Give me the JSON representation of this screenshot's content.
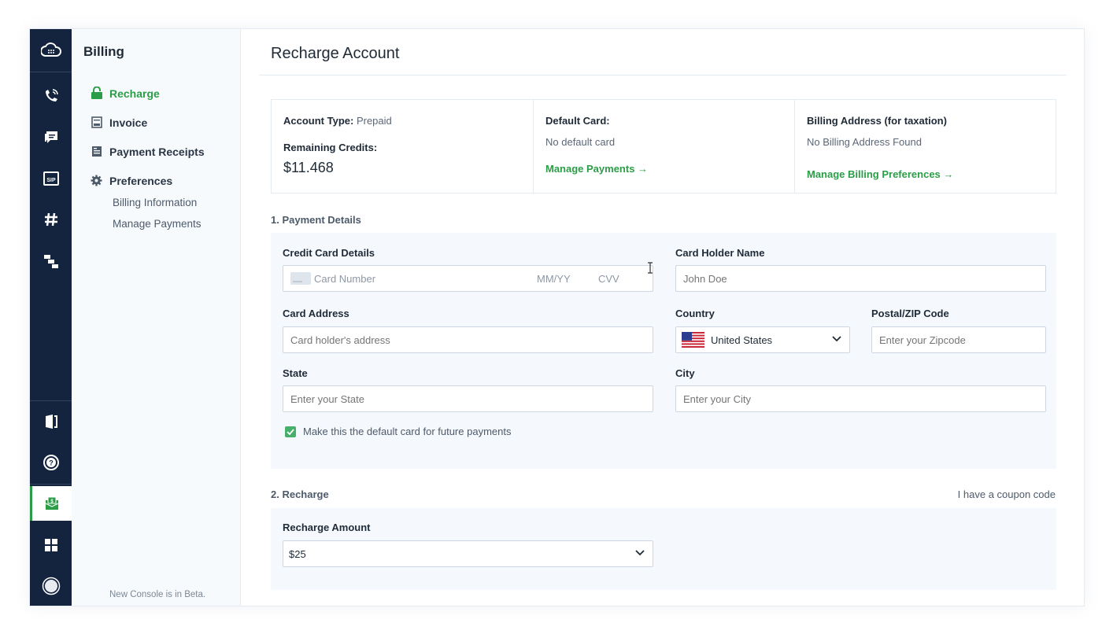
{
  "rail": {
    "icons": [
      "cloud-logo-icon",
      "phone-icon",
      "message-icon",
      "sip-icon",
      "hash-icon",
      "flow-icon",
      "docs-icon",
      "help-icon",
      "billing-icon",
      "apps-icon",
      "profile-icon"
    ],
    "sip_text": "SIP",
    "active": "billing-icon"
  },
  "sidebar": {
    "title": "Billing",
    "items": [
      {
        "label": "Recharge",
        "icon": "lock-icon",
        "active": true
      },
      {
        "label": "Invoice",
        "icon": "invoice-icon",
        "active": false
      },
      {
        "label": "Payment Receipts",
        "icon": "receipt-icon",
        "active": false
      },
      {
        "label": "Preferences",
        "icon": "gear-icon",
        "active": false
      }
    ],
    "sub_items": [
      "Billing Information",
      "Manage Payments"
    ],
    "footer": "New Console is in Beta."
  },
  "page": {
    "title": "Recharge Account"
  },
  "summary": {
    "account_type_label": "Account Type:",
    "account_type_value": "Prepaid",
    "remaining_label": "Remaining Credits:",
    "remaining_value": "$11.468",
    "default_card_label": "Default Card:",
    "default_card_value": "No default card",
    "manage_payments": "Manage Payments →",
    "billing_address_label": "Billing Address (for taxation)",
    "billing_address_value": "No Billing Address Found",
    "manage_billing": "Manage Billing Preferences →"
  },
  "payment": {
    "section_title": "1. Payment Details",
    "credit_card_label": "Credit Card Details",
    "card_number_placeholder": "Card Number",
    "expiry_placeholder": "MM/YY",
    "cvv_placeholder": "CVV",
    "holder_label": "Card Holder Name",
    "holder_placeholder": "John Doe",
    "address_label": "Card Address",
    "address_placeholder": "Card holder's address",
    "country_label": "Country",
    "country_value": "United States",
    "zip_label": "Postal/ZIP Code",
    "zip_placeholder": "Enter your Zipcode",
    "state_label": "State",
    "state_placeholder": "Enter your State",
    "city_label": "City",
    "city_placeholder": "Enter your City",
    "default_checkbox": "Make this the default card for future payments",
    "default_checked": true
  },
  "recharge": {
    "section_title": "2. Recharge",
    "coupon_link": "I have a coupon code",
    "amount_label": "Recharge Amount",
    "amount_value": "$25"
  },
  "colors": {
    "rail_bg": "#14243f",
    "accent_green": "#2a9d46",
    "panel_bg": "#f5f9fd"
  }
}
